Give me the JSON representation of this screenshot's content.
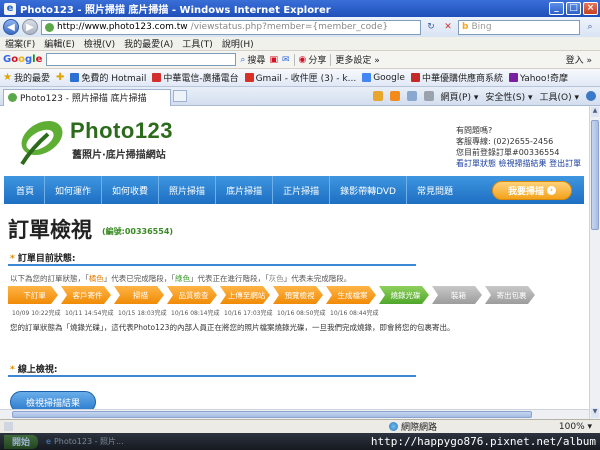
{
  "window": {
    "title": "Photo123 - 照片掃描 底片掃描 - Windows Internet Explorer",
    "min": "_",
    "max": "□",
    "close": "×"
  },
  "address": {
    "domain": "http://www.photo123.com.tw",
    "path": "/viewstatus.php?member={member_code}",
    "search_placeholder": "Bing"
  },
  "menu": [
    "檔案(F)",
    "編輯(E)",
    "檢視(V)",
    "我的最愛(A)",
    "工具(T)",
    "說明(H)"
  ],
  "google_toolbar": {
    "logo": [
      "G",
      "o",
      "o",
      "g",
      "l",
      "e"
    ],
    "items": [
      "搜尋",
      "分享",
      "更多設定 »"
    ],
    "login": "登入 »"
  },
  "favorites": {
    "label": "我的最愛",
    "items": [
      {
        "label": "免費的 Hotmail",
        "color": "#2a6fd1"
      },
      {
        "label": "中華電信-廣播電台",
        "color": "#d32f2f"
      },
      {
        "label": "Gmail - 收件匣 (3) - k...",
        "color": "#d93025"
      },
      {
        "label": "Google",
        "color": "#4285f4"
      },
      {
        "label": "中華優購供應商系統",
        "color": "#c62828"
      },
      {
        "label": "Yahoo!奇摩",
        "color": "#7b1fa2"
      }
    ]
  },
  "tab": {
    "label": "Photo123 - 照片掃描 底片掃描",
    "commands": [
      "網頁(P) ▾",
      "安全性(S) ▾",
      "工具(O) ▾"
    ]
  },
  "site": {
    "brand": "Photo123",
    "tagline": "舊照片·底片掃描網站",
    "contact": {
      "q": "有問題嗎?",
      "phone": "客服專線: (02)2655-2456",
      "login": "您目前登錄訂單#00336554",
      "links": "看訂單狀態  檢視掃描結果  登出訂單"
    },
    "nav": [
      "首頁",
      "如何運作",
      "如何收費",
      "照片掃描",
      "底片掃描",
      "正片掃描",
      "錄影帶轉DVD",
      "常見問題"
    ],
    "scan_button": "我要掃描",
    "scan_button_icon": "›"
  },
  "order": {
    "title": "訂單檢視",
    "number": "(編號:00336554)",
    "status_heading": "訂單目前狀態:",
    "legend": {
      "pre": "以下為您的訂單狀態，「",
      "orange": "橘色",
      "mid1": "」代表已完成階段，「",
      "green": "綠色",
      "mid2": "」代表正在進行階段，「",
      "gray": "灰色",
      "post": "」代表未完成階段。"
    },
    "steps": [
      {
        "label": "下訂單",
        "state": "done",
        "time": "10/09 10:22完成"
      },
      {
        "label": "客戶寄件",
        "state": "done",
        "time": "10/11 14:54完成"
      },
      {
        "label": "掃描",
        "state": "done",
        "time": "10/15 18:03完成"
      },
      {
        "label": "品質檢查",
        "state": "done",
        "time": "10/16 08:14完成"
      },
      {
        "label": "上傳至網站",
        "state": "done",
        "time": "10/16 17:03完成"
      },
      {
        "label": "預覽檢視",
        "state": "done",
        "time": "10/16 08:50完成"
      },
      {
        "label": "生成檔案",
        "state": "done",
        "time": "10/16 08:44完成"
      },
      {
        "label": "燒錄光碟",
        "state": "active",
        "time": ""
      },
      {
        "label": "裝箱",
        "state": "pending",
        "time": ""
      },
      {
        "label": "寄出包裹",
        "state": "pending",
        "time": ""
      }
    ],
    "status_message": "您的訂單狀態為「燒錄光碟」，這代表Photo123的內部人員正在將您的照片檔案燒錄光碟，一旦我們完成燒錄，即會將您的包裹寄出。",
    "online_heading": "線上檢視:",
    "view_button": "檢視掃描結果"
  },
  "statusbar": {
    "zone": "網際網路",
    "zoom": "100% ▾"
  },
  "taskbar": {
    "start": "開始",
    "task": "Photo123 - 照片..."
  },
  "watermark": "http://happygo876.pixnet.net/album",
  "colors": {
    "nav_blue": "#1e6fc2",
    "step_done": "#f08b06",
    "step_active": "#4fa62a",
    "step_pending": "#9c9c9c",
    "brand_green": "#2d6b1c"
  }
}
